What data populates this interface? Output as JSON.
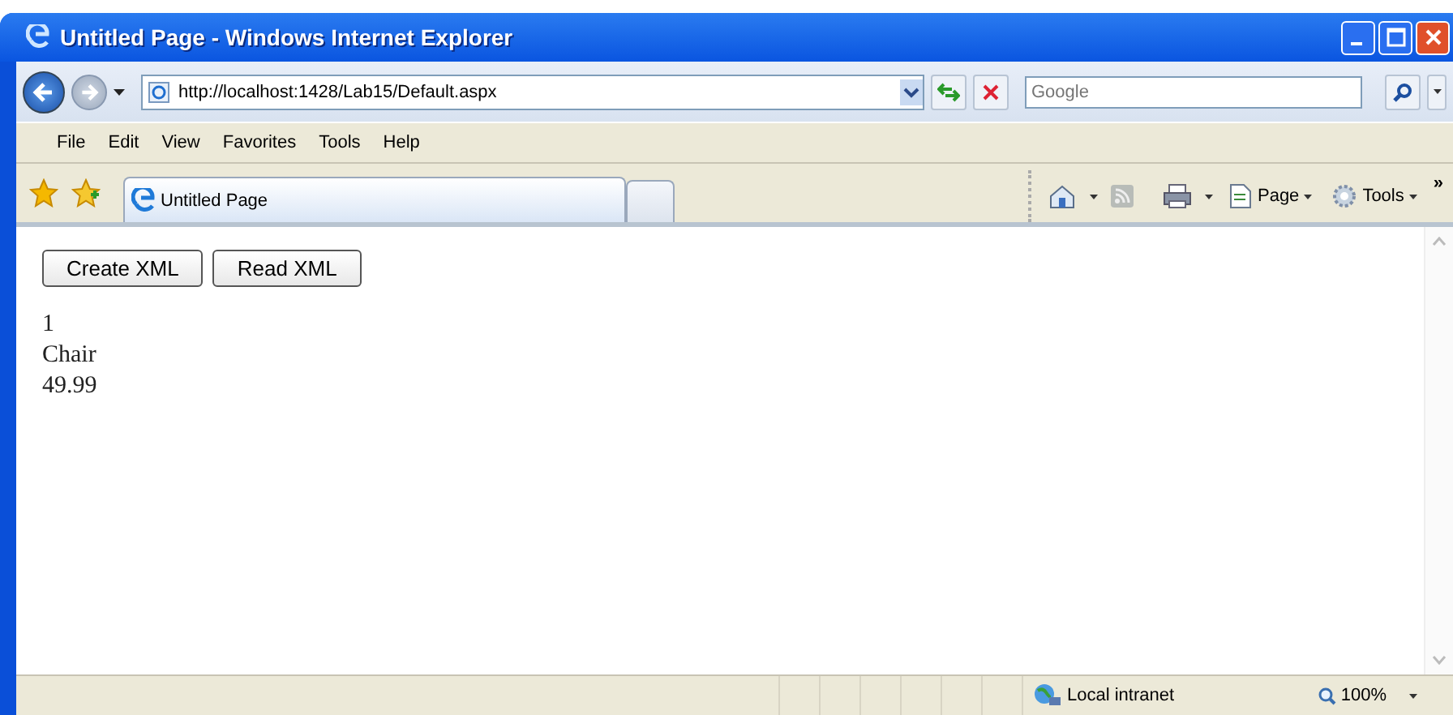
{
  "window": {
    "title": "Untitled Page - Windows Internet Explorer"
  },
  "address_bar": {
    "url": "http://localhost:1428/Lab15/Default.aspx"
  },
  "search": {
    "placeholder": "Google"
  },
  "menu": [
    "File",
    "Edit",
    "View",
    "Favorites",
    "Tools",
    "Help"
  ],
  "tabs": [
    {
      "label": "Untitled Page",
      "selected": true
    }
  ],
  "command_bar": {
    "page_label": "Page",
    "tools_label": "Tools",
    "overflow": "»"
  },
  "page": {
    "buttons": [
      "Create XML",
      "Read XML"
    ],
    "output": [
      "1",
      "Chair",
      "49.99"
    ]
  },
  "status_bar": {
    "zone": "Local intranet",
    "zoom": "100%"
  }
}
